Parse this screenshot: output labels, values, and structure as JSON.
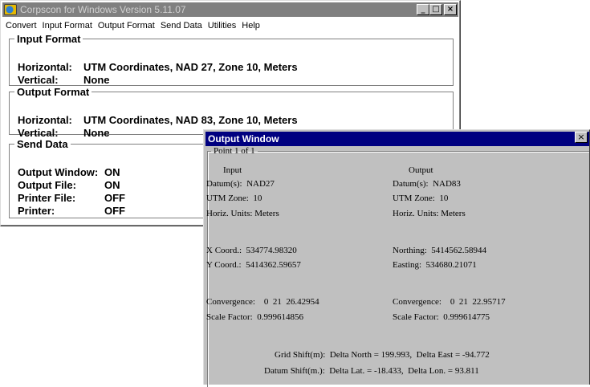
{
  "main_window": {
    "title": "Corpscon for Windows Version 5.11.07",
    "buttons": {
      "minimize": "_",
      "maximize": "□",
      "close": "×"
    },
    "menu": [
      {
        "label": "Convert"
      },
      {
        "label": "Input Format"
      },
      {
        "label": "Output Format"
      },
      {
        "label": "Send Data"
      },
      {
        "label": "Utilities"
      },
      {
        "label": "Help"
      }
    ],
    "input_format": {
      "legend": "Input Format",
      "horizontal_label": "Horizontal:",
      "horizontal_value": "UTM Coordinates, NAD 27, Zone 10, Meters",
      "vertical_label": "Vertical:",
      "vertical_value": "None"
    },
    "output_format": {
      "legend": "Output Format",
      "horizontal_label": "Horizontal:",
      "horizontal_value": "UTM Coordinates, NAD 83, Zone 10, Meters",
      "vertical_label": "Vertical:",
      "vertical_value": "None"
    },
    "send_data": {
      "legend": "Send Data",
      "rows": [
        {
          "label": "Output Window:",
          "value": "ON"
        },
        {
          "label": "Output File:",
          "value": "ON"
        },
        {
          "label": "Printer File:",
          "value": "OFF"
        },
        {
          "label": "Printer:",
          "value": "OFF"
        }
      ]
    }
  },
  "output_window": {
    "title": "Output Window",
    "close": "×",
    "point_legend": "Point 1 of 1",
    "input": {
      "header": "Input",
      "datum": "Datum(s):  NAD27",
      "zone": "UTM Zone:  10",
      "units": "Horiz. Units: Meters",
      "coord1": "X Coord.:  534774.98320",
      "coord2": "Y Coord.:  5414362.59657",
      "convergence": "Convergence:    0  21  26.42954",
      "scale_factor": "Scale Factor:  0.999614856"
    },
    "output": {
      "header": "Output",
      "datum": "Datum(s):  NAD83",
      "zone": "UTM Zone:  10",
      "units": "Horiz. Units: Meters",
      "coord1": "Northing:  5414562.58944",
      "coord2": "Easting:  534680.21071",
      "convergence": "Convergence:    0  21  22.95717",
      "scale_factor": "Scale Factor:  0.999614775"
    },
    "grid_shift": "Grid Shift(m):  Delta North = 199.993,  Delta East = -94.772",
    "datum_shift": "Datum Shift(m.):  Delta Lat. = -18.433,  Delta Lon. = 93.811"
  }
}
